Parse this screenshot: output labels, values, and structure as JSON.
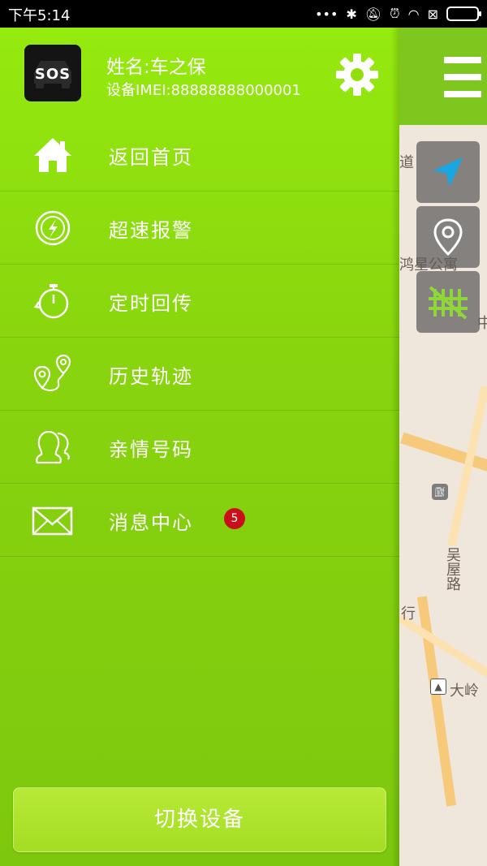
{
  "status_bar": {
    "time": "下午5:14"
  },
  "profile": {
    "avatar_text": "SOS",
    "name": "姓名:车之保",
    "imei": "设备IMEI:88888888000001"
  },
  "menu": [
    {
      "label": "返回首页",
      "icon": "home-icon"
    },
    {
      "label": "超速报警",
      "icon": "speed-alarm-icon"
    },
    {
      "label": "定时回传",
      "icon": "stopwatch-icon"
    },
    {
      "label": "历史轨迹",
      "icon": "history-track-icon"
    },
    {
      "label": "亲情号码",
      "icon": "contacts-icon"
    },
    {
      "label": "消息中心",
      "icon": "mail-icon",
      "badge": "5"
    }
  ],
  "switch_button": {
    "label": "切换设备"
  },
  "map": {
    "labels": {
      "poi1": "鸿星公寓",
      "road1": "吴屋路",
      "poi2": "大岭",
      "frag1": "行",
      "frag2": "道",
      "frag3": "中"
    }
  },
  "colors": {
    "drawer_green": "#88d40e",
    "header_green": "#7dc71e",
    "badge_red": "#c9101a",
    "nav_blue": "#1aa6e0"
  }
}
